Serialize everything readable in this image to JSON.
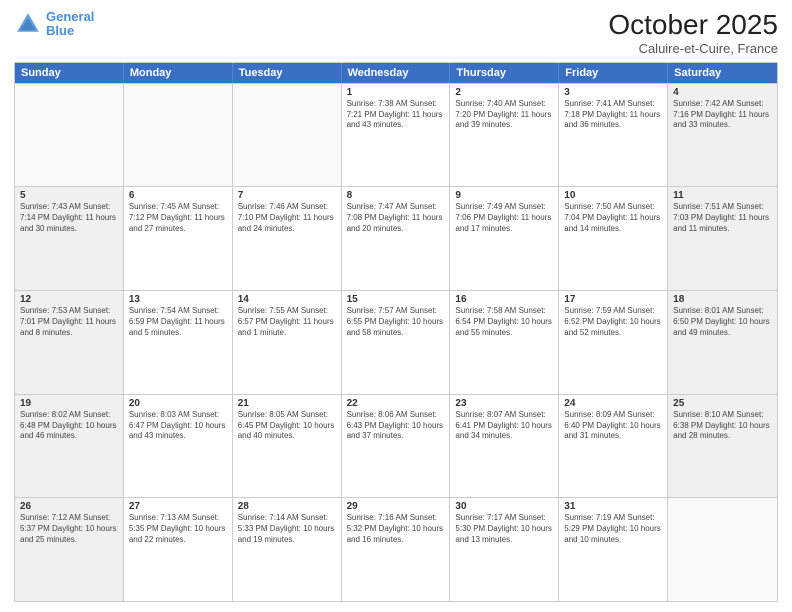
{
  "header": {
    "logo_line1": "General",
    "logo_line2": "Blue",
    "month": "October 2025",
    "location": "Caluire-et-Cuire, France"
  },
  "days_of_week": [
    "Sunday",
    "Monday",
    "Tuesday",
    "Wednesday",
    "Thursday",
    "Friday",
    "Saturday"
  ],
  "weeks": [
    [
      {
        "day": "",
        "info": "",
        "empty": true
      },
      {
        "day": "",
        "info": "",
        "empty": true
      },
      {
        "day": "",
        "info": "",
        "empty": true
      },
      {
        "day": "1",
        "info": "Sunrise: 7:38 AM\nSunset: 7:21 PM\nDaylight: 11 hours and 43 minutes."
      },
      {
        "day": "2",
        "info": "Sunrise: 7:40 AM\nSunset: 7:20 PM\nDaylight: 11 hours and 39 minutes."
      },
      {
        "day": "3",
        "info": "Sunrise: 7:41 AM\nSunset: 7:18 PM\nDaylight: 11 hours and 36 minutes."
      },
      {
        "day": "4",
        "info": "Sunrise: 7:42 AM\nSunset: 7:16 PM\nDaylight: 11 hours and 33 minutes.",
        "shaded": true
      }
    ],
    [
      {
        "day": "5",
        "info": "Sunrise: 7:43 AM\nSunset: 7:14 PM\nDaylight: 11 hours and 30 minutes.",
        "shaded": true
      },
      {
        "day": "6",
        "info": "Sunrise: 7:45 AM\nSunset: 7:12 PM\nDaylight: 11 hours and 27 minutes."
      },
      {
        "day": "7",
        "info": "Sunrise: 7:46 AM\nSunset: 7:10 PM\nDaylight: 11 hours and 24 minutes."
      },
      {
        "day": "8",
        "info": "Sunrise: 7:47 AM\nSunset: 7:08 PM\nDaylight: 11 hours and 20 minutes."
      },
      {
        "day": "9",
        "info": "Sunrise: 7:49 AM\nSunset: 7:06 PM\nDaylight: 11 hours and 17 minutes."
      },
      {
        "day": "10",
        "info": "Sunrise: 7:50 AM\nSunset: 7:04 PM\nDaylight: 11 hours and 14 minutes."
      },
      {
        "day": "11",
        "info": "Sunrise: 7:51 AM\nSunset: 7:03 PM\nDaylight: 11 hours and 11 minutes.",
        "shaded": true
      }
    ],
    [
      {
        "day": "12",
        "info": "Sunrise: 7:53 AM\nSunset: 7:01 PM\nDaylight: 11 hours and 8 minutes.",
        "shaded": true
      },
      {
        "day": "13",
        "info": "Sunrise: 7:54 AM\nSunset: 6:59 PM\nDaylight: 11 hours and 5 minutes."
      },
      {
        "day": "14",
        "info": "Sunrise: 7:55 AM\nSunset: 6:57 PM\nDaylight: 11 hours and 1 minute."
      },
      {
        "day": "15",
        "info": "Sunrise: 7:57 AM\nSunset: 6:55 PM\nDaylight: 10 hours and 58 minutes."
      },
      {
        "day": "16",
        "info": "Sunrise: 7:58 AM\nSunset: 6:54 PM\nDaylight: 10 hours and 55 minutes."
      },
      {
        "day": "17",
        "info": "Sunrise: 7:59 AM\nSunset: 6:52 PM\nDaylight: 10 hours and 52 minutes."
      },
      {
        "day": "18",
        "info": "Sunrise: 8:01 AM\nSunset: 6:50 PM\nDaylight: 10 hours and 49 minutes.",
        "shaded": true
      }
    ],
    [
      {
        "day": "19",
        "info": "Sunrise: 8:02 AM\nSunset: 6:48 PM\nDaylight: 10 hours and 46 minutes.",
        "shaded": true
      },
      {
        "day": "20",
        "info": "Sunrise: 8:03 AM\nSunset: 6:47 PM\nDaylight: 10 hours and 43 minutes."
      },
      {
        "day": "21",
        "info": "Sunrise: 8:05 AM\nSunset: 6:45 PM\nDaylight: 10 hours and 40 minutes."
      },
      {
        "day": "22",
        "info": "Sunrise: 8:06 AM\nSunset: 6:43 PM\nDaylight: 10 hours and 37 minutes."
      },
      {
        "day": "23",
        "info": "Sunrise: 8:07 AM\nSunset: 6:41 PM\nDaylight: 10 hours and 34 minutes."
      },
      {
        "day": "24",
        "info": "Sunrise: 8:09 AM\nSunset: 6:40 PM\nDaylight: 10 hours and 31 minutes."
      },
      {
        "day": "25",
        "info": "Sunrise: 8:10 AM\nSunset: 6:38 PM\nDaylight: 10 hours and 28 minutes.",
        "shaded": true
      }
    ],
    [
      {
        "day": "26",
        "info": "Sunrise: 7:12 AM\nSunset: 5:37 PM\nDaylight: 10 hours and 25 minutes.",
        "shaded": true
      },
      {
        "day": "27",
        "info": "Sunrise: 7:13 AM\nSunset: 5:35 PM\nDaylight: 10 hours and 22 minutes."
      },
      {
        "day": "28",
        "info": "Sunrise: 7:14 AM\nSunset: 5:33 PM\nDaylight: 10 hours and 19 minutes."
      },
      {
        "day": "29",
        "info": "Sunrise: 7:16 AM\nSunset: 5:32 PM\nDaylight: 10 hours and 16 minutes."
      },
      {
        "day": "30",
        "info": "Sunrise: 7:17 AM\nSunset: 5:30 PM\nDaylight: 10 hours and 13 minutes."
      },
      {
        "day": "31",
        "info": "Sunrise: 7:19 AM\nSunset: 5:29 PM\nDaylight: 10 hours and 10 minutes."
      },
      {
        "day": "",
        "info": "",
        "empty": true,
        "shaded": true
      }
    ]
  ]
}
